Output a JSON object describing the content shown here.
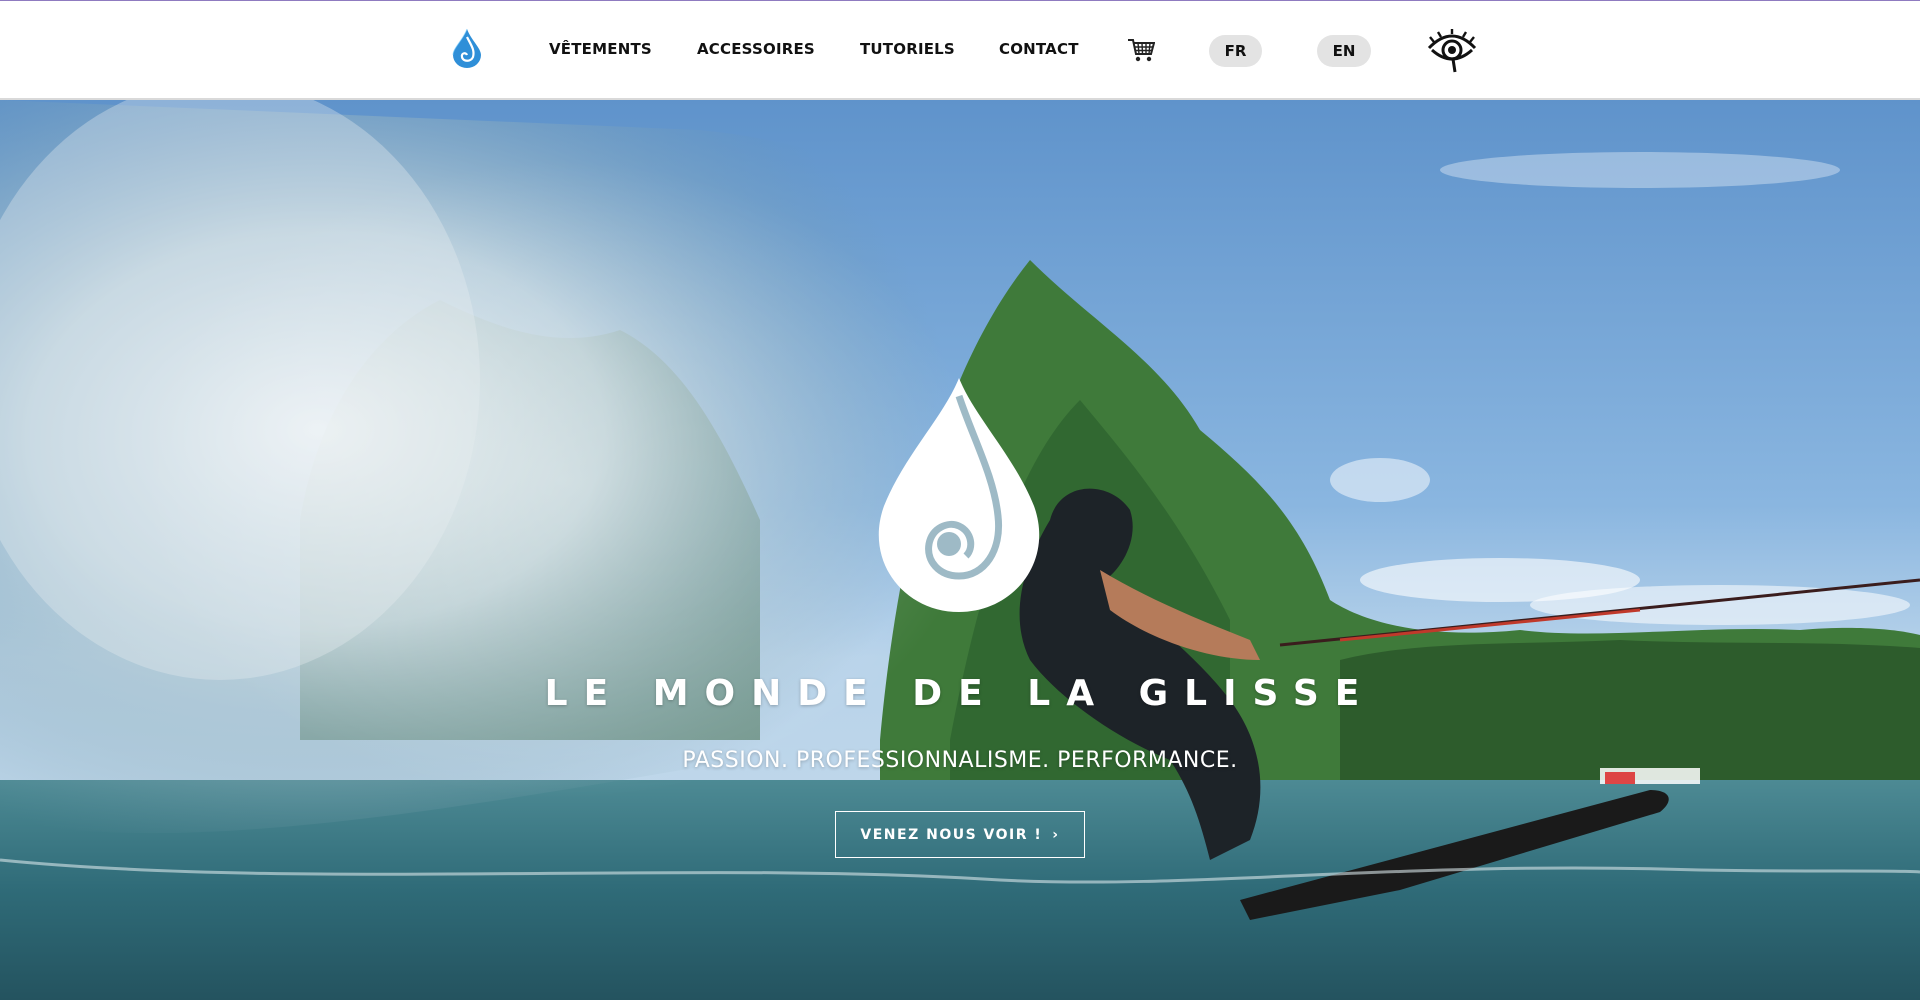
{
  "header": {
    "logo_icon": "water-drop-logo-icon",
    "nav": [
      {
        "label": "VÊTEMENTS"
      },
      {
        "label": "ACCESSOIRES"
      },
      {
        "label": "TUTORIELS"
      },
      {
        "label": "CONTACT"
      }
    ],
    "cart_icon": "shopping-cart-icon",
    "languages": [
      {
        "label": "FR"
      },
      {
        "label": "EN"
      }
    ],
    "accessibility_icon": "eye-icon"
  },
  "hero": {
    "logo_icon": "water-drop-logo-icon",
    "title": "LE MONDE DE LA GLISSE",
    "subtitle": "PASSION. PROFESSIONNALISME. PERFORMANCE.",
    "cta_label": "VENEZ NOUS VOIR !",
    "cta_icon": "chevron-right-icon",
    "background_image": "water-skier-photo"
  },
  "colors": {
    "accent_blue": "#2f8fd8",
    "header_bg": "#ffffff",
    "lang_bg": "#e3e3e3",
    "text_dark": "#111111",
    "hero_text": "#ffffff"
  }
}
